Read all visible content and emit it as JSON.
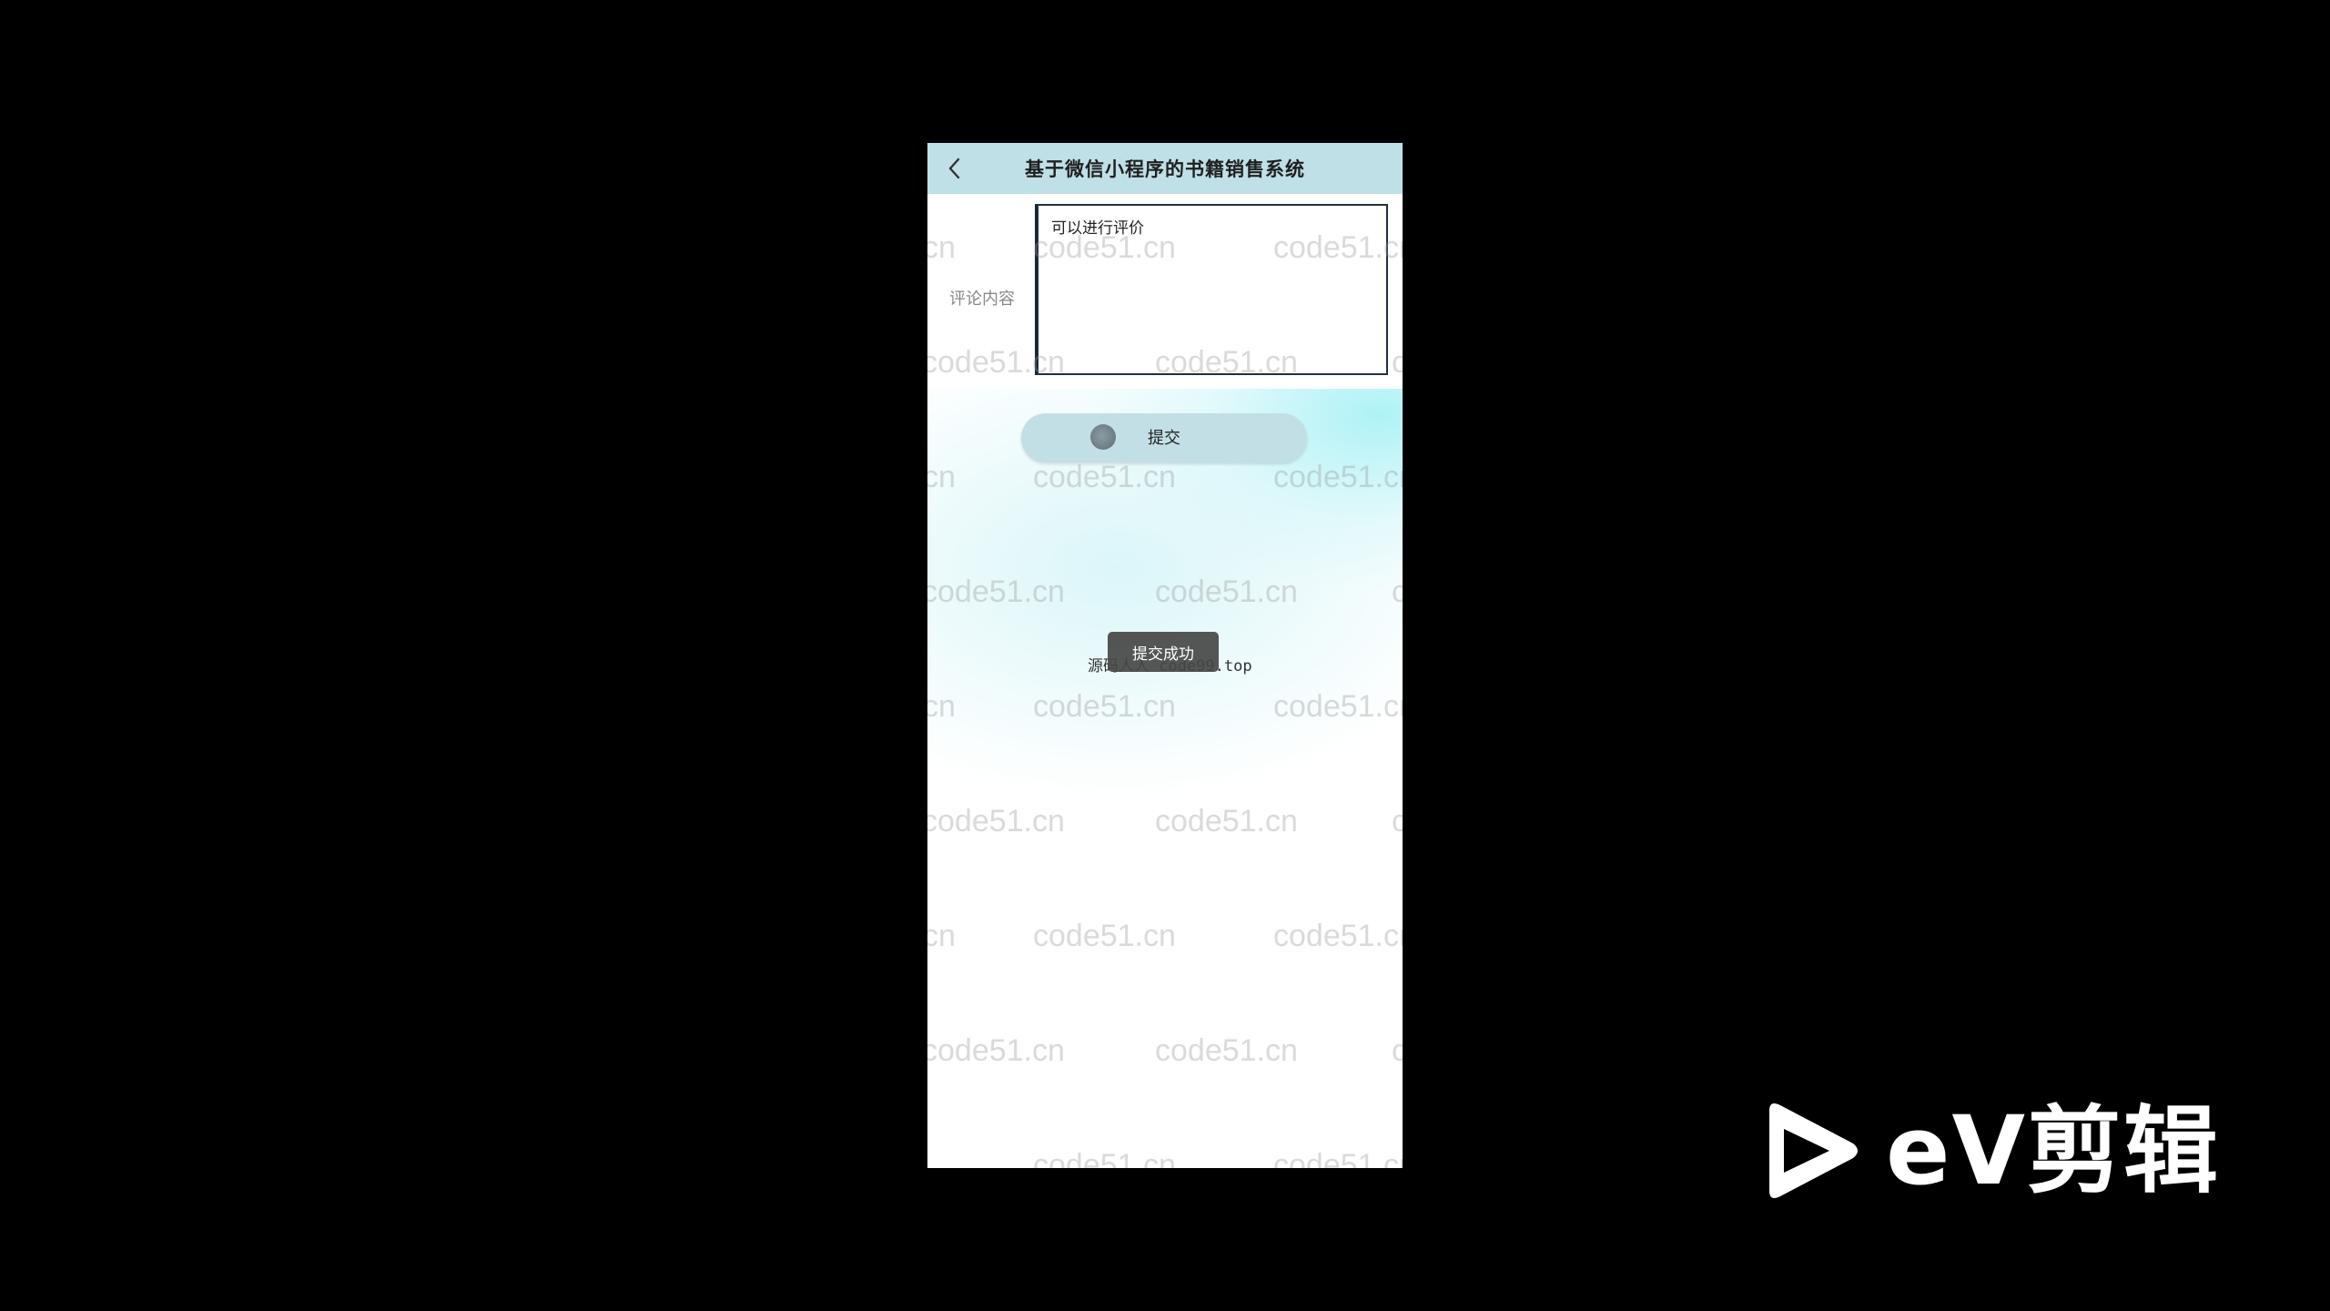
{
  "app": {
    "title": "基于微信小程序的书籍销售系统"
  },
  "form": {
    "label": "评论内容",
    "content_value": "可以进行评价"
  },
  "submit": {
    "label": "提交"
  },
  "toast": {
    "message": "提交成功"
  },
  "footer": {
    "text": "源码人人 code99.top"
  },
  "watermark": {
    "text": "code51.cn"
  },
  "video_logo": {
    "text": "eV剪辑"
  },
  "colors": {
    "navbar": "#bfe0e6",
    "button": "#c2dfe5",
    "toast": "#464646",
    "accent_glow": "#a0f0f5"
  },
  "icons": {
    "back": "chevron-left-icon",
    "loading": "loading-spinner-icon",
    "logo": "play-triangle-icon"
  }
}
